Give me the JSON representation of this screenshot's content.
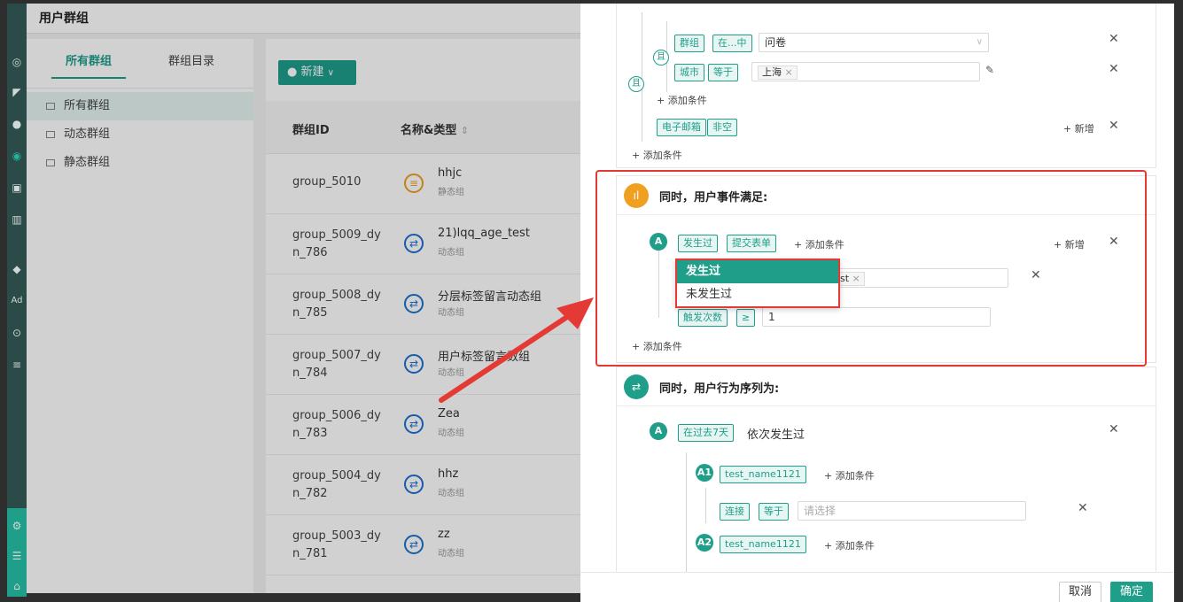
{
  "app": {
    "page_title": "用户群组"
  },
  "left_tabs": [
    {
      "label": "所有群组"
    },
    {
      "label": "群组目录"
    }
  ],
  "tree": [
    {
      "label": "所有群组"
    },
    {
      "label": "动态群组"
    },
    {
      "label": "静态群组"
    }
  ],
  "toolbar": {
    "new_label": "新建",
    "new_caret": "∨"
  },
  "table": {
    "headers": {
      "id": "群组ID",
      "name_type": "名称&类型",
      "sort_icon": "⇕"
    },
    "rows": [
      {
        "id": "group_5010",
        "name": "hhjc",
        "type": "静态组",
        "kind": "static"
      },
      {
        "id": "group_5009_dyn_786",
        "name": "21)lqq_age_test",
        "type": "动态组",
        "kind": "dynamic"
      },
      {
        "id": "group_5008_dyn_785",
        "name": "分层标签留言动态组",
        "type": "动态组",
        "kind": "dynamic"
      },
      {
        "id": "group_5007_dyn_784",
        "name": "用户标签留言数组",
        "type": "动态组",
        "kind": "dynamic"
      },
      {
        "id": "group_5006_dyn_783",
        "name": "Zea",
        "type": "动态组",
        "kind": "dynamic"
      },
      {
        "id": "group_5004_dyn_782",
        "name": "hhz",
        "type": "动态组",
        "kind": "dynamic"
      },
      {
        "id": "group_5003_dyn_781",
        "name": "zz",
        "type": "动态组",
        "kind": "dynamic"
      }
    ]
  },
  "drawer": {
    "top_block": {
      "and_label": "且",
      "inner_and_label": "且",
      "cond1": {
        "field": "群组",
        "op": "在...中",
        "value": "问卷"
      },
      "cond2": {
        "field": "城市",
        "op": "等于",
        "value_chip": "上海"
      },
      "add_condition": "+ 添加条件",
      "cond3": {
        "field": "电子邮箱",
        "op": "非空",
        "add": "+ 新增"
      },
      "outer_add_condition": "+ 添加条件"
    },
    "event_section": {
      "title": "同时，用户事件满足:",
      "badge": "A",
      "tag1": "发生过",
      "tag2": "提交表单",
      "add_condition": "+ 添加条件",
      "add_new": "+ 新增",
      "hidden_chip": "st",
      "trigger_field": "触发次数",
      "trigger_op": "≥",
      "trigger_value": "1",
      "bottom_add": "+ 添加条件",
      "dropdown": [
        "发生过",
        "未发生过"
      ]
    },
    "sequence_section": {
      "title": "同时，用户行为序列为:",
      "badge": "A",
      "period_tag": "在过去7天",
      "order_text": "依次发生过",
      "a1": {
        "badge": "A1",
        "event": "test_name1121",
        "add": "+ 添加条件"
      },
      "a1_cond": {
        "field": "连接",
        "op": "等于",
        "placeholder": "请选择"
      },
      "a2": {
        "badge": "A2",
        "event": "test_name1121",
        "add": "+ 添加条件"
      }
    },
    "footer": {
      "cancel": "取消",
      "ok": "确定"
    }
  },
  "colors": {
    "brand": "#1f9e8a",
    "highlight": "#e53935",
    "dynamic_icon": "#1f6fd1",
    "static_icon": "#f0a020"
  }
}
